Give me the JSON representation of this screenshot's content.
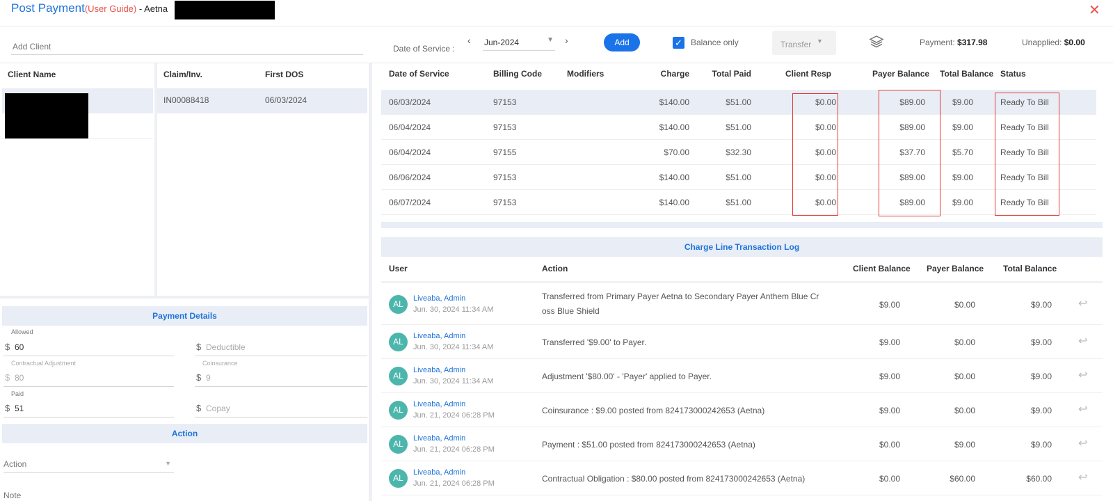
{
  "header": {
    "title": "Post Payment",
    "guide": "(User Guide)",
    "payer": " - Aetna",
    "close_symbol": "✕"
  },
  "toolbar": {
    "add_client_placeholder": "Add Client",
    "dos_label": "Date of Service :",
    "dos_value": "Jun-2024",
    "add_label": "Add",
    "balance_only_label": "Balance only",
    "transfer_label": "Transfer",
    "payment_label": "Payment:",
    "payment_value": "$317.98",
    "unapplied_label": "Unapplied:",
    "unapplied_value": "$0.00"
  },
  "client_table": {
    "header": "Client Name"
  },
  "claim_table": {
    "headers": [
      "Claim/Inv.",
      "First DOS"
    ],
    "rows": [
      {
        "claim": "IN00088418",
        "dos": "06/03/2024"
      }
    ]
  },
  "charges": {
    "headers": [
      "Date of Service",
      "Billing Code",
      "Modifiers",
      "Charge",
      "Total Paid",
      "Client Resp",
      "Payer Balance",
      "Total Balance",
      "Status"
    ],
    "rows": [
      {
        "dos": "06/03/2024",
        "code": "97153",
        "mod": "",
        "charge": "$140.00",
        "paid": "$51.00",
        "client": "$0.00",
        "payer": "$89.00",
        "total": "$9.00",
        "status": "Ready To Bill"
      },
      {
        "dos": "06/04/2024",
        "code": "97153",
        "mod": "",
        "charge": "$140.00",
        "paid": "$51.00",
        "client": "$0.00",
        "payer": "$89.00",
        "total": "$9.00",
        "status": "Ready To Bill"
      },
      {
        "dos": "06/04/2024",
        "code": "97155",
        "mod": "",
        "charge": "$70.00",
        "paid": "$32.30",
        "client": "$0.00",
        "payer": "$37.70",
        "total": "$5.70",
        "status": "Ready To Bill"
      },
      {
        "dos": "06/06/2024",
        "code": "97153",
        "mod": "",
        "charge": "$140.00",
        "paid": "$51.00",
        "client": "$0.00",
        "payer": "$89.00",
        "total": "$9.00",
        "status": "Ready To Bill"
      },
      {
        "dos": "06/07/2024",
        "code": "97153",
        "mod": "",
        "charge": "$140.00",
        "paid": "$51.00",
        "client": "$0.00",
        "payer": "$89.00",
        "total": "$9.00",
        "status": "Ready To Bill"
      }
    ]
  },
  "log": {
    "title": "Charge Line Transaction Log",
    "headers": [
      "User",
      "Action",
      "Client Balance",
      "Payer Balance",
      "Total Balance"
    ],
    "rows": [
      {
        "initials": "AL",
        "user": "Liveaba, Admin",
        "date": "Jun. 30, 2024 11:34 AM",
        "action1": "Transferred from Primary Payer Aetna to Secondary Payer Anthem Blue Cr",
        "action2": "oss Blue Shield",
        "client": "$9.00",
        "payer": "$0.00",
        "total": "$9.00"
      },
      {
        "initials": "AL",
        "user": "Liveaba, Admin",
        "date": "Jun. 30, 2024 11:34 AM",
        "action1": "Transferred '$9.00' to Payer.",
        "action2": "",
        "client": "$9.00",
        "payer": "$0.00",
        "total": "$9.00"
      },
      {
        "initials": "AL",
        "user": "Liveaba, Admin",
        "date": "Jun. 30, 2024 11:34 AM",
        "action1": "Adjustment '$80.00' - 'Payer' applied to Payer.",
        "action2": "",
        "client": "$9.00",
        "payer": "$0.00",
        "total": "$9.00"
      },
      {
        "initials": "AL",
        "user": "Liveaba, Admin",
        "date": "Jun. 21, 2024 06:28 PM",
        "action1": "Coinsurance : $9.00 posted from 824173000242653 (Aetna)",
        "action2": "",
        "client": "$9.00",
        "payer": "$0.00",
        "total": "$9.00"
      },
      {
        "initials": "AL",
        "user": "Liveaba, Admin",
        "date": "Jun. 21, 2024 06:28 PM",
        "action1": "Payment : $51.00 posted from 824173000242653 (Aetna)",
        "action2": "",
        "client": "$0.00",
        "payer": "$9.00",
        "total": "$9.00"
      },
      {
        "initials": "AL",
        "user": "Liveaba, Admin",
        "date": "Jun. 21, 2024 06:28 PM",
        "action1": "Contractual Obligation : $80.00 posted from 824173000242653 (Aetna)",
        "action2": "",
        "client": "$0.00",
        "payer": "$60.00",
        "total": "$60.00"
      }
    ]
  },
  "payment_details": {
    "title": "Payment Details",
    "allowed_label": "Allowed",
    "allowed_value": "60",
    "deductible_placeholder": "Deductible",
    "contractual_label": "Contractual Adjustment",
    "contractual_value": "80",
    "coinsurance_label": "Coinsurance",
    "coinsurance_value": "9",
    "paid_label": "Paid",
    "paid_value": "51",
    "copay_placeholder": "Copay",
    "currency": "$"
  },
  "action_section": {
    "title": "Action",
    "action_placeholder": "Action",
    "note_label": "Note"
  }
}
